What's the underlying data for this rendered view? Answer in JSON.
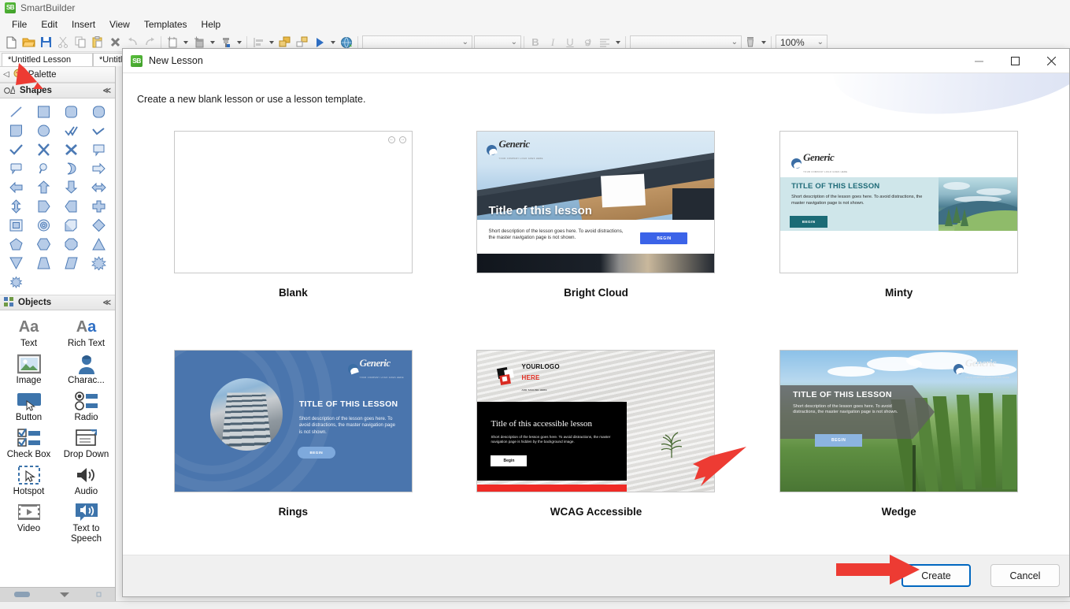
{
  "app": {
    "title": "SmartBuilder",
    "logo_text": "SB",
    "accent": "#3f9e29"
  },
  "menubar": {
    "items": [
      "File",
      "Edit",
      "Insert",
      "View",
      "Templates",
      "Help"
    ]
  },
  "toolbar": {
    "icons": [
      "new-file-icon",
      "open-folder-icon",
      "save-icon",
      "cut-icon",
      "copy-icon",
      "paste-icon",
      "delete-icon",
      "undo-icon",
      "redo-icon",
      "add-page-icon",
      "add-layer-icon",
      "format-painter-icon",
      "align-icon",
      "group-icon",
      "ungroup-icon",
      "play-icon",
      "publish-web-icon"
    ],
    "font_family_value": "",
    "font_size_value": "",
    "style_buttons": [
      "bold-icon",
      "italic-icon",
      "underline-icon",
      "link-icon",
      "align-text-icon"
    ],
    "theme_value": "",
    "zoom_value": "100%"
  },
  "tabs": [
    {
      "label": "*Untitled Lesson",
      "selected": true
    },
    {
      "label": "*Untitl",
      "selected": false
    }
  ],
  "left_panel": {
    "header": {
      "label": "Palette",
      "icon": "palette-icon",
      "collapse_icon": "collapse-left-icon"
    },
    "shapes_section": {
      "title": "Shapes",
      "icon": "shapes-icon",
      "collapse_icon": "chevrons-icon",
      "items": [
        "line-shape",
        "square-shape",
        "rounded-square-shape",
        "rounded-rect-shape",
        "rounded-corner-shape",
        "circle-shape",
        "double-check-shape",
        "check-wave-shape",
        "check-shape",
        "cross-scissors-shape",
        "x-cross-shape",
        "callout-flag-shape",
        "callout-shape",
        "magnifier-shape",
        "moon-shape",
        "right-arrow-shape",
        "left-arrow-shape",
        "up-arrow-shape",
        "down-arrow-shape",
        "left-right-arrow-shape",
        "up-down-arrow-shape",
        "pentagon-right-shape",
        "chevron-shape",
        "cross-plus-shape",
        "frame-shape",
        "donut-shape",
        "cube-shape",
        "diamond-shape",
        "pentagon-shape",
        "hexagon-shape",
        "octagon-shape",
        "triangle-shape",
        "triangle-down-shape",
        "trapezoid-shape",
        "parallelogram-shape",
        "starburst-shape",
        "explosion-shape"
      ]
    },
    "objects_section": {
      "title": "Objects",
      "icon": "objects-icon",
      "collapse_icon": "chevrons-icon",
      "items": [
        {
          "label": "Text",
          "icon": "text-icon"
        },
        {
          "label": "Rich Text",
          "icon": "rich-text-icon"
        },
        {
          "label": "Image",
          "icon": "image-icon"
        },
        {
          "label": "Charac...",
          "icon": "character-icon"
        },
        {
          "label": "Button",
          "icon": "button-icon"
        },
        {
          "label": "Radio",
          "icon": "radio-icon"
        },
        {
          "label": "Check Box",
          "icon": "checkbox-icon"
        },
        {
          "label": "Drop Down",
          "icon": "dropdown-icon"
        },
        {
          "label": "Hotspot",
          "icon": "hotspot-icon"
        },
        {
          "label": "Audio",
          "icon": "audio-icon"
        },
        {
          "label": "Video",
          "icon": "video-icon"
        },
        {
          "label": "Text to Speech",
          "icon": "text-to-speech-icon"
        }
      ]
    }
  },
  "dialog": {
    "title": "New Lesson",
    "icon": "smartbuilder-icon",
    "subtitle": "Create a new blank lesson or use a lesson template.",
    "window_buttons": {
      "minimize": "minimize-icon",
      "maximize": "maximize-icon",
      "close": "close-icon"
    },
    "templates": [
      {
        "name": "Blank",
        "kind": "blank",
        "nav_back": "←",
        "nav_next": "→"
      },
      {
        "name": "Bright Cloud",
        "kind": "bright-cloud",
        "logo": "Generic",
        "logo_tagline": "YOUR COMPANY LOGO GOES HERE",
        "title": "Title of this lesson",
        "description": "Short description of the lesson goes here. To avoid distractions, the master navigation page is not shown.",
        "button": "BEGIN"
      },
      {
        "name": "Minty",
        "kind": "minty",
        "logo": "Generic",
        "logo_tagline": "YOUR COMPANY LOGO GOES HERE",
        "title": "TITLE OF THIS LESSON",
        "description": "Short description of the lesson goes here. To avoid distractions, the master navigation page is not shown.",
        "button": "BEGIN"
      },
      {
        "name": "Rings",
        "kind": "rings",
        "logo": "Generic",
        "logo_tagline": "YOUR COMPANY LOGO GOES HERE",
        "title": "TITLE OF THIS LESSON",
        "description": "Short description of the lesson goes here. To avoid distractions, the master navigation page is not shown.",
        "button": "BEGIN"
      },
      {
        "name": "WCAG Accessible",
        "kind": "wcag",
        "logo_line1": "YOURLOGO",
        "logo_line2": "HERE",
        "logo_line3": "ADD TAGLINE HERE",
        "title": "Title of this accessible lesson",
        "description": "Short description of the lesson goes here. To avoid distractions, the master navigation page is hidden by the background image.",
        "button": "Begin"
      },
      {
        "name": "Wedge",
        "kind": "wedge",
        "logo": "Generic",
        "logo_tagline": "YOUR COMPANY LOGO GOES HERE",
        "title": "TITLE OF THIS LESSON",
        "description": "Short description of the lesson goes here. To avoid distractions, the master navigation page is not shown.",
        "button": "BEGIN"
      }
    ],
    "buttons": {
      "create": "Create",
      "cancel": "Cancel"
    }
  },
  "annotations": {
    "arrow_color": "#ed3b33",
    "arrows": [
      "pointer-to-new-file-toolbar",
      "pointer-to-wcag-template",
      "pointer-to-create-button"
    ]
  }
}
